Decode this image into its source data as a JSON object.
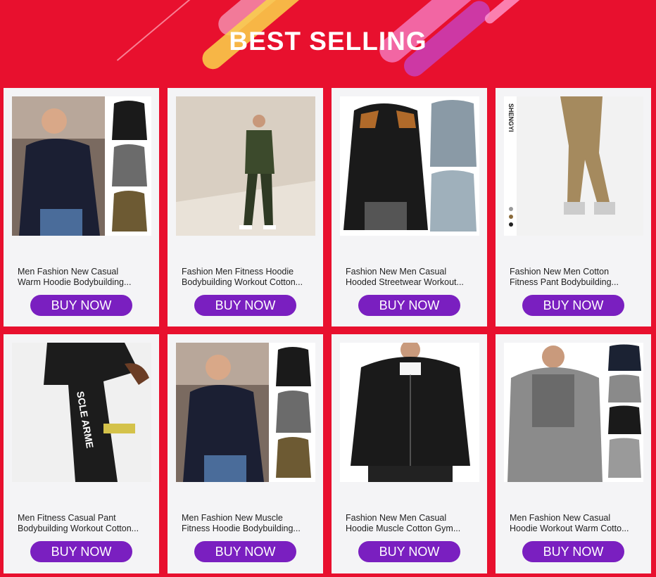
{
  "banner": {
    "title": "BEST SELLING"
  },
  "colors": {
    "background": "#e8102e",
    "card": "#f4f4f6",
    "button": "#7a1fc0"
  },
  "products": [
    {
      "line1": "Men Fashion New Casual",
      "line2": "Warm Hoodie Bodybuilding...",
      "button": "BUY NOW",
      "image": "hoodie-man-with-variants"
    },
    {
      "line1": "Fashion Men Fitness Hoodie",
      "line2": "Bodybuilding Workout Cotton...",
      "button": "BUY NOW",
      "image": "man-green-tracksuit"
    },
    {
      "line1": "Fashion New Men Casual",
      "line2": "Hooded Streetwear Workout...",
      "button": "BUY NOW",
      "image": "zip-hoodie-variants"
    },
    {
      "line1": "Fashion New Men Cotton",
      "line2": "Fitness Pant Bodybuilding...",
      "button": "BUY NOW",
      "image": "khaki-cargo-pants"
    },
    {
      "line1": "Men Fitness Casual Pant",
      "line2": "Bodybuilding Workout Cotton...",
      "button": "BUY NOW",
      "image": "black-jogger-pants"
    },
    {
      "line1": "Men Fashion New Muscle",
      "line2": "Fitness Hoodie Bodybuilding...",
      "button": "BUY NOW",
      "image": "hoodie-man-with-variants"
    },
    {
      "line1": "Fashion New Men Casual",
      "line2": "Hoodie Muscle Cotton Gym...",
      "button": "BUY NOW",
      "image": "black-zip-hoodie"
    },
    {
      "line1": "Men Fashion New Casual",
      "line2": "Hoodie Workout Warm Cotto...",
      "button": "BUY NOW",
      "image": "raglan-hoodie-variants"
    }
  ]
}
